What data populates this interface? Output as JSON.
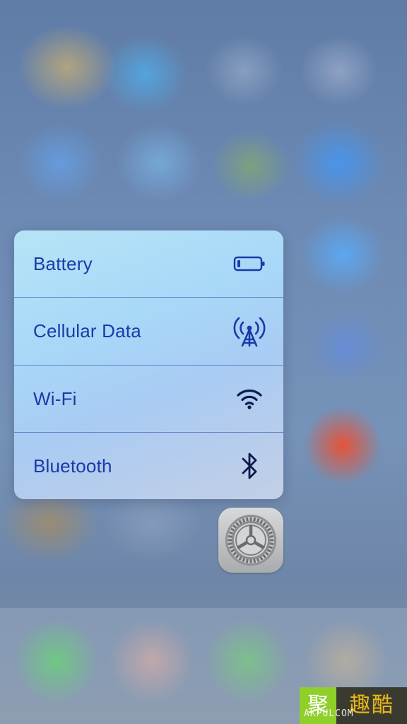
{
  "quick_actions": [
    {
      "label": "Battery",
      "icon": "battery-icon"
    },
    {
      "label": "Cellular Data",
      "icon": "cellular-antenna-icon"
    },
    {
      "label": "Wi-Fi",
      "icon": "wifi-icon"
    },
    {
      "label": "Bluetooth",
      "icon": "bluetooth-icon"
    }
  ],
  "app": {
    "name": "Settings",
    "icon": "settings-gear-icon"
  },
  "colors": {
    "menu_text": "#1a3aa8",
    "menu_background": "#a8d8f8",
    "divider": "#2846a0"
  },
  "watermark": {
    "left_char": "聚",
    "right_text": "趣酷",
    "domain": "AKPULCOM"
  }
}
